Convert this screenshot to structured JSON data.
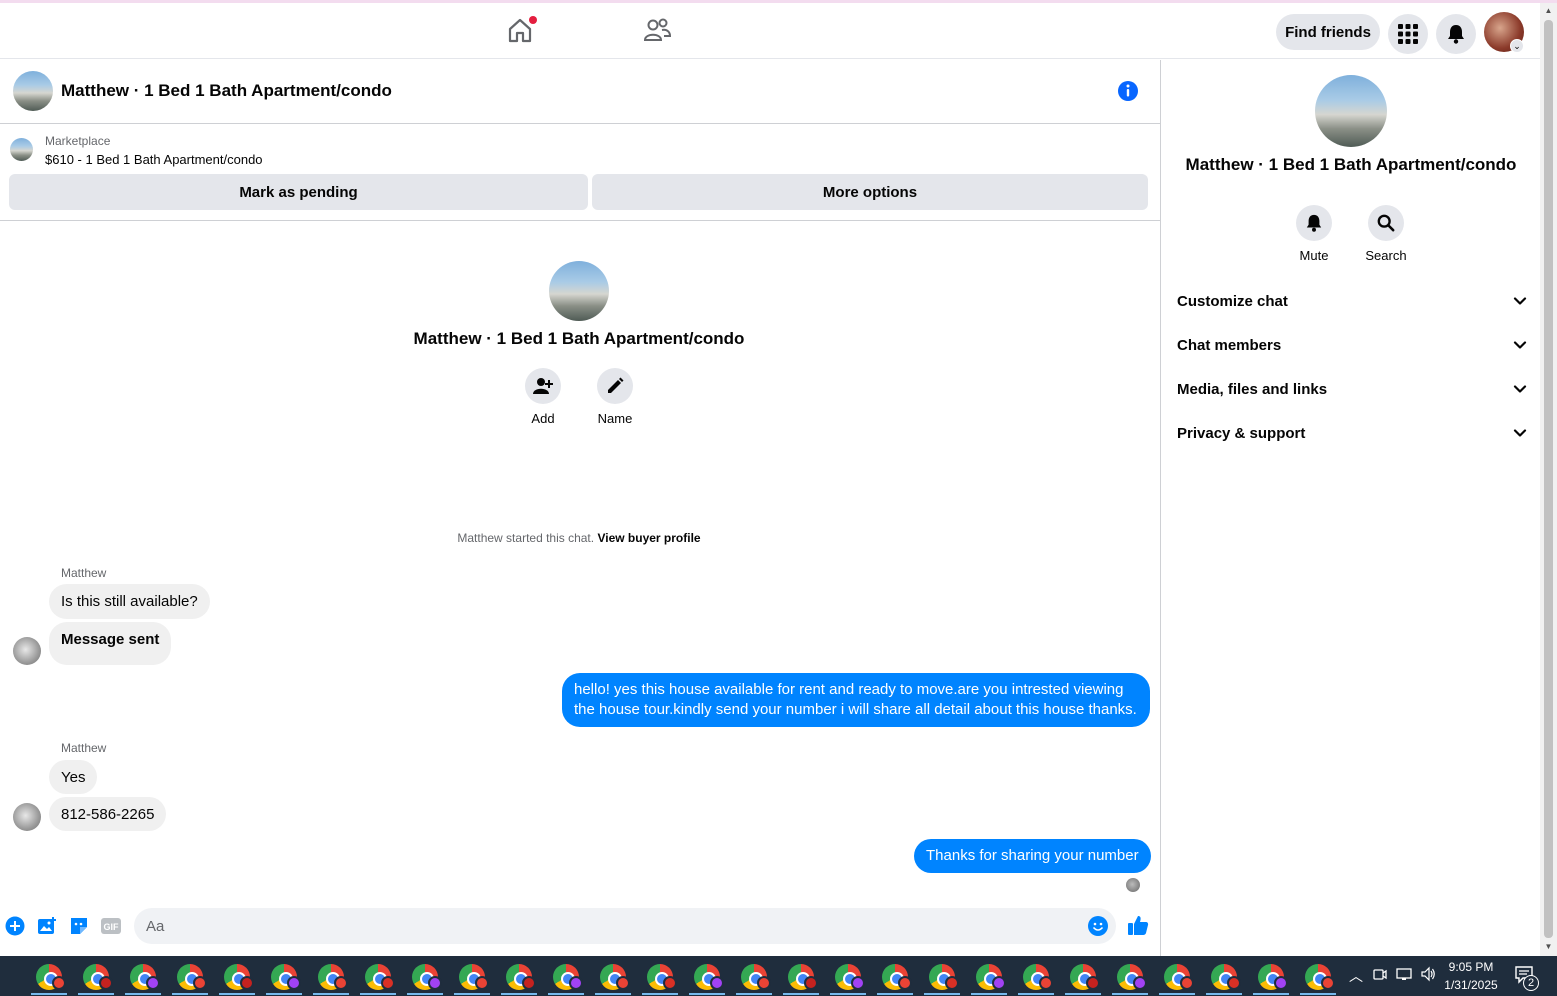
{
  "topnav": {
    "find_friends": "Find friends"
  },
  "conversation": {
    "title": "Matthew · 1 Bed 1 Bath Apartment/condo"
  },
  "marketplace": {
    "label": "Marketplace",
    "item": "$610 - 1 Bed 1 Bath Apartment/condo",
    "mark_pending": "Mark as pending",
    "more_options": "More options"
  },
  "intro": {
    "title": "Matthew · 1 Bed 1 Bath Apartment/condo",
    "add_label": "Add",
    "name_label": "Name",
    "started_text": "Matthew started this chat.",
    "view_buyer": "View buyer profile"
  },
  "messages": [
    {
      "sender": "Matthew",
      "text": "Is this still available?"
    },
    {
      "text": "Message sent"
    },
    {
      "text": "hello! yes this house available for rent and ready to move.are you intrested viewing the house tour.kindly send your number i will share all detail about this house thanks."
    },
    {
      "sender": "Matthew",
      "text": "Yes"
    },
    {
      "text": "812-586-2265"
    },
    {
      "text": "Thanks for sharing your number"
    }
  ],
  "composer": {
    "placeholder": "Aa"
  },
  "panel": {
    "title": "Matthew · 1 Bed 1 Bath Apartment/condo",
    "mute": "Mute",
    "search": "Search",
    "sections": [
      "Customize chat",
      "Chat members",
      "Media, files and links",
      "Privacy & support"
    ]
  },
  "taskbar": {
    "time": "9:05 PM",
    "date": "1/31/2025",
    "notification_count": "2"
  },
  "colors": {
    "accent": "#0084ff",
    "info": "#0866ff",
    "taskbar": "#1f2d3d"
  }
}
